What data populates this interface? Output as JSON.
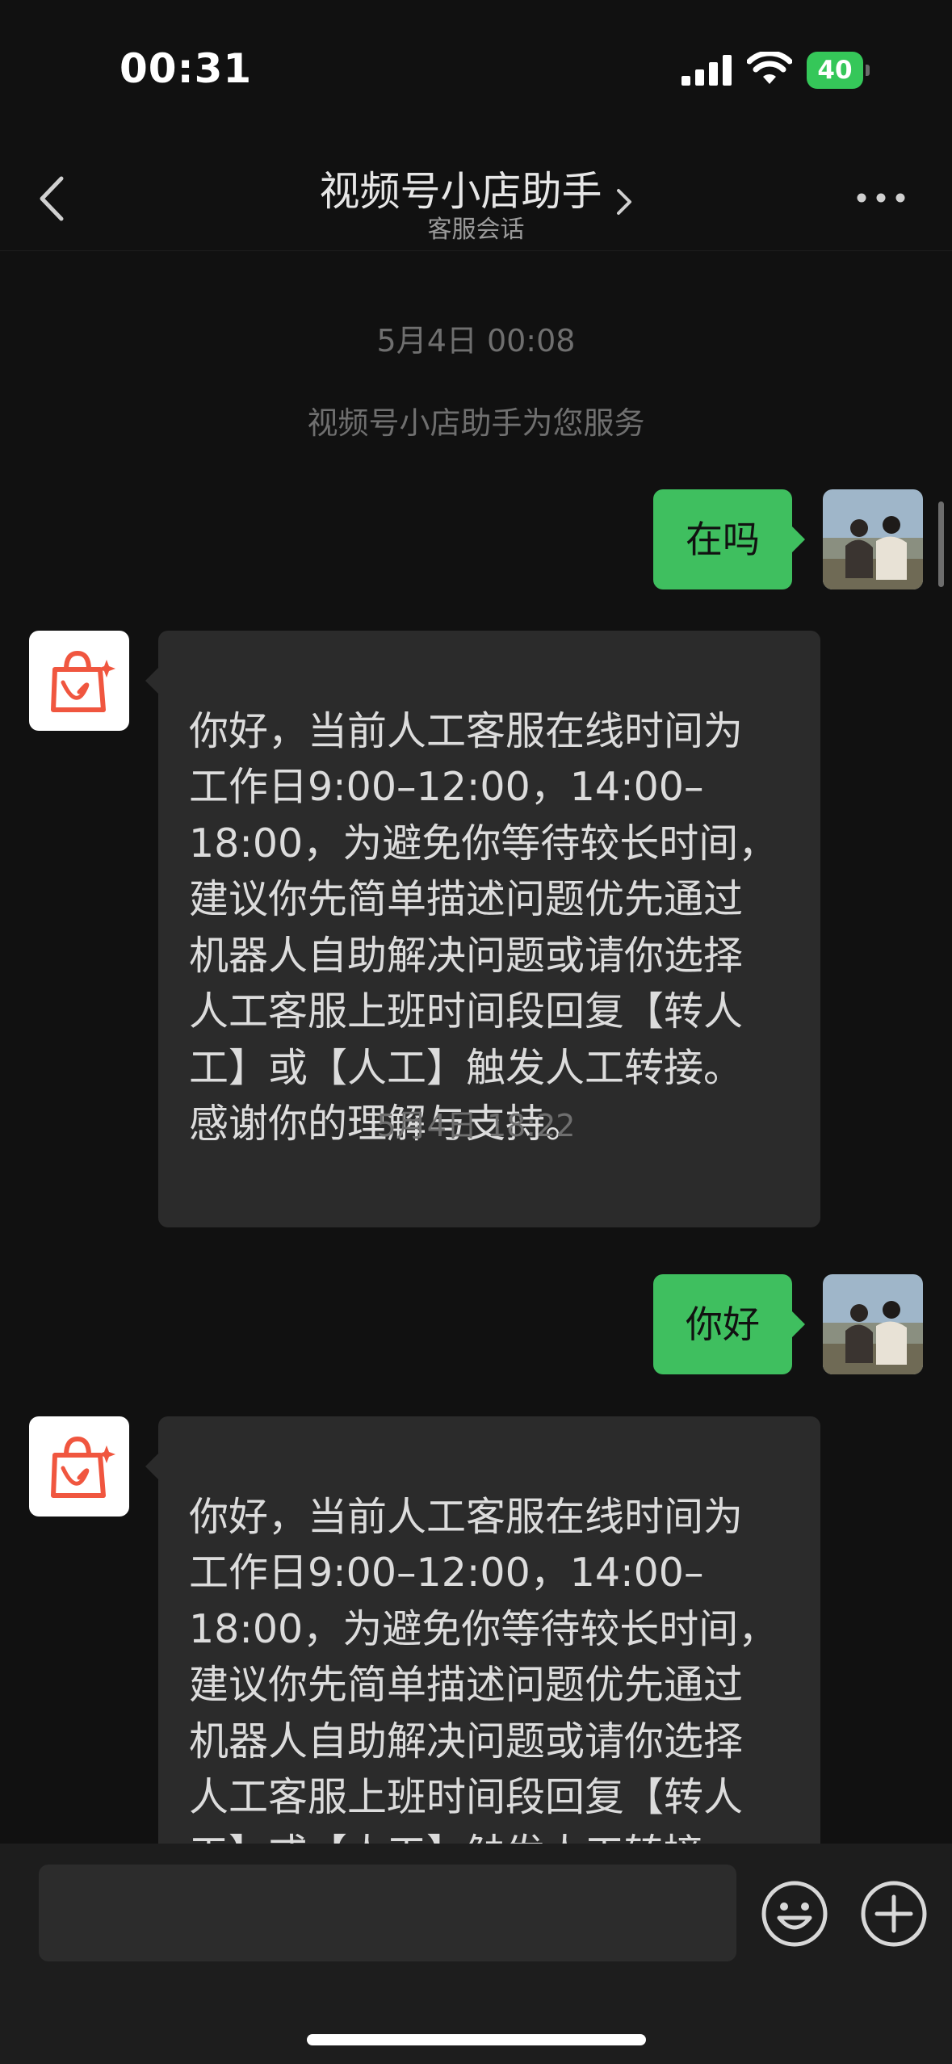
{
  "status_bar": {
    "time": "00:31",
    "battery_level": "40"
  },
  "nav": {
    "title": "视频号小店助手",
    "subtitle": "客服会话",
    "back_icon": "chevron-left-icon",
    "more_icon": "ellipsis-icon"
  },
  "chat": {
    "timestamp_1": "5月4日 00:08",
    "system_notice": "视频号小店助手为您服务",
    "outgoing_1": "在吗",
    "incoming_1": "你好，当前人工客服在线时间为\n工作日9:00–12:00，14:00–\n18:00，为避免你等待较长时间，\n建议你先简单描述问题优先通过\n机器人自助解决问题或请你选择\n人工客服上班时间段回复【转人\n工】或【人工】触发人工转接。\n感谢你的理解与支持。",
    "timestamp_2": "5月4日 18:22",
    "outgoing_2": "你好",
    "incoming_2": "你好，当前人工客服在线时间为\n工作日9:00–12:00，14:00–\n18:00，为避免你等待较长时间，\n建议你先简单描述问题优先通过\n机器人自助解决问题或请你选择\n人工客服上班时间段回复【转人\n工】或【人工】触发人工转接。\n感谢你的理解与支持。"
  },
  "input_bar": {
    "emoji_icon": "smiley-icon",
    "plus_icon": "plus-circle-icon"
  },
  "colors": {
    "background": "#111111",
    "outgoing_bubble": "#3fbf5f",
    "incoming_bubble": "#2b2b2b",
    "battery": "#35c759"
  }
}
